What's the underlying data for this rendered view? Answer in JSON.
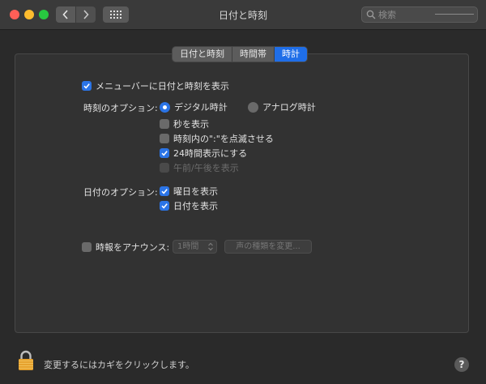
{
  "window": {
    "title": "日付と時刻"
  },
  "search": {
    "placeholder": "検索"
  },
  "tabs": [
    {
      "label": "日付と時刻",
      "active": false
    },
    {
      "label": "時間帯",
      "active": false
    },
    {
      "label": "時計",
      "active": true
    }
  ],
  "clock": {
    "show_in_menubar": {
      "label": "メニューバーに日付と時刻を表示",
      "checked": true
    },
    "time_options": {
      "label": "時刻のオプション:",
      "digital": {
        "label": "デジタル時計",
        "selected": true
      },
      "analog": {
        "label": "アナログ時計",
        "selected": false
      },
      "show_seconds": {
        "label": "秒を表示",
        "checked": false
      },
      "flash_separators": {
        "label": "時刻内の\":\"を点滅させる",
        "checked": false
      },
      "use_24_hour": {
        "label": "24時間表示にする",
        "checked": true
      },
      "show_ampm": {
        "label": "午前/午後を表示",
        "checked": false,
        "disabled": true
      }
    },
    "date_options": {
      "label": "日付のオプション:",
      "show_weekday": {
        "label": "曜日を表示",
        "checked": true
      },
      "show_date": {
        "label": "日付を表示",
        "checked": true
      }
    },
    "announce": {
      "label": "時報をアナウンス:",
      "checked": false,
      "interval": "1時間",
      "voice_button": "声の種類を変更..."
    }
  },
  "footer": {
    "lock_text": "変更するにはカギをクリックします。",
    "help": "?"
  },
  "colors": {
    "accent": "#2b74e6",
    "close": "#ff5f57",
    "minimize": "#febc2e",
    "maximize": "#28c840"
  },
  "icons": [
    "search-icon",
    "chevron-left-icon",
    "chevron-right-icon",
    "grid-icon",
    "lock-icon",
    "help-icon",
    "checkmark-icon",
    "updown-arrows-icon"
  ]
}
